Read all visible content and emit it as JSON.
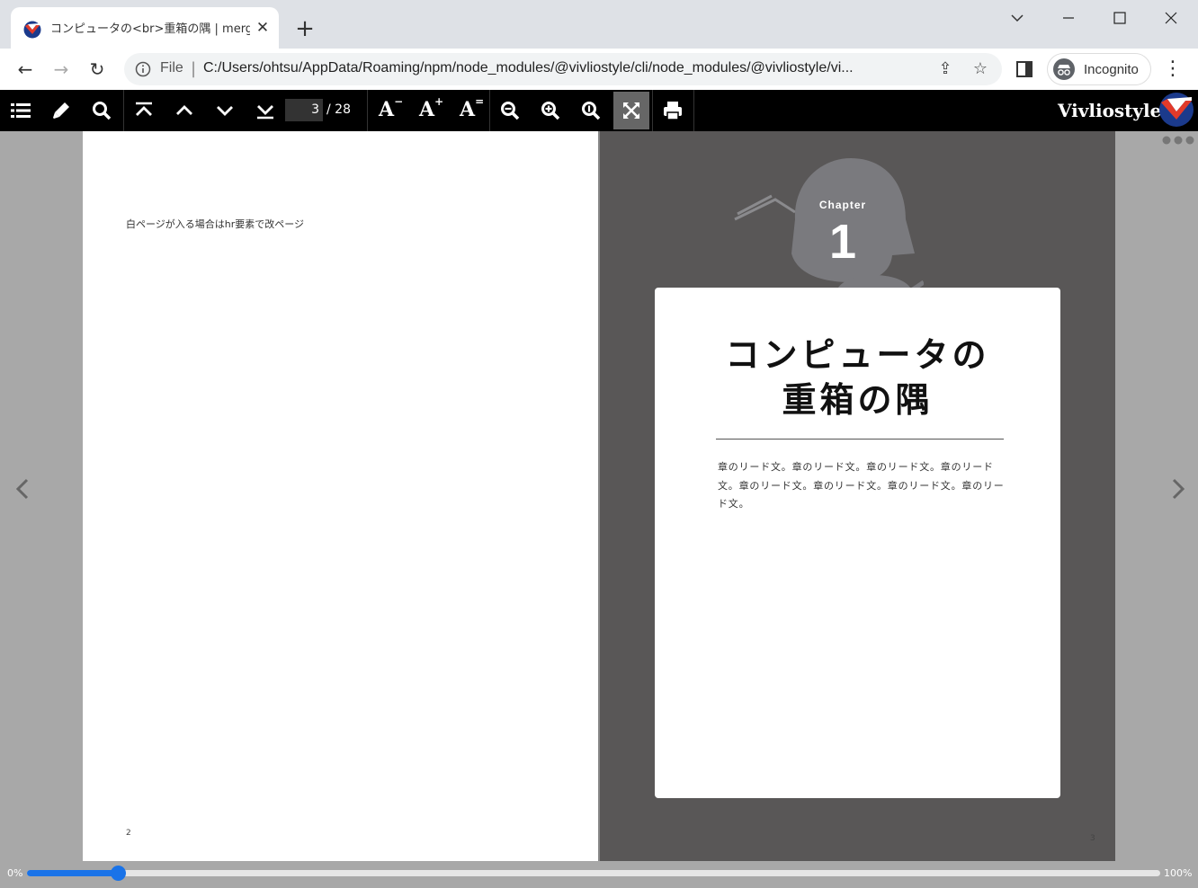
{
  "browser": {
    "tab_title": "コンピュータの<br>重箱の隅 | merge",
    "tab_close": "✕",
    "new_tab": "+",
    "window_controls": {
      "tab_search": "⌄",
      "minimize": "—",
      "maximize": "☐",
      "close": "✕"
    },
    "nav": {
      "back": "←",
      "forward": "→",
      "reload": "↻"
    },
    "omnibox": {
      "scheme_label": "File",
      "separator": "|",
      "url": "C:/Users/ohtsu/AppData/Roaming/npm/node_modules/@vivliostyle/cli/node_modules/@vivliostyle/vi..."
    },
    "share_icon": "⇪",
    "bookmark_icon": "☆",
    "incognito_label": "Incognito",
    "menu_icon": "⋮"
  },
  "viewer_toolbar": {
    "page_current": "3",
    "page_total": "/ 28",
    "brand": "Vivliostyle",
    "icons": [
      "toc-icon",
      "marker-icon",
      "search-icon",
      "first-page-icon",
      "previous-page-icon",
      "next-page-icon",
      "last-page-icon",
      "font-smaller-icon",
      "font-larger-icon",
      "font-default-icon",
      "zoom-out-icon",
      "zoom-in-icon",
      "actual-size-icon",
      "fit-page-icon",
      "print-icon"
    ],
    "font_glyph": "A",
    "font_smaller_mark": "−",
    "font_larger_mark": "+",
    "font_default_mark": "="
  },
  "left_page": {
    "text": "白ページが入る場合はhr要素で改ページ",
    "page_number": "2"
  },
  "right_page": {
    "chapter_label": "Chapter",
    "chapter_number": "1",
    "title_line1": "コンピュータの",
    "title_line2": "重箱の隅",
    "lead": "章のリード文。章のリード文。章のリード文。章のリード文。章のリード文。章のリード文。章のリード文。章のリード文。",
    "page_number": "3"
  },
  "progress": {
    "start_label": "0%",
    "end_label": "100%",
    "value": 0.08
  },
  "colors": {
    "accent": "#1a73e8",
    "right_page_bg": "#595757",
    "viewer_bg": "#a8a8a8"
  }
}
